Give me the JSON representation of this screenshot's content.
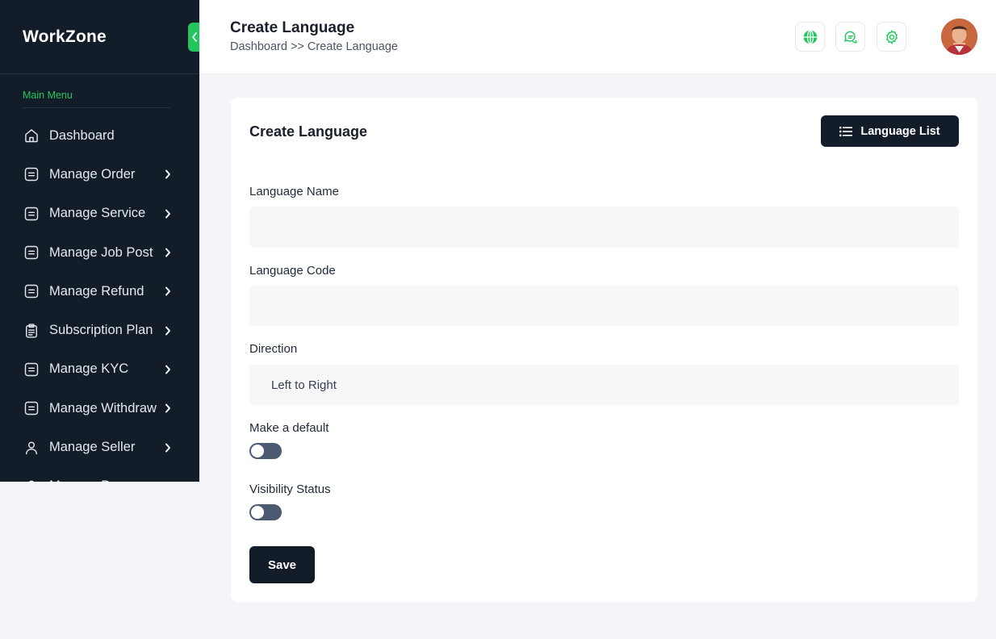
{
  "sidebar": {
    "brand": "WorkZone",
    "menu_label": "Main Menu",
    "items": [
      {
        "label": "Dashboard",
        "icon": "home-icon",
        "has_chevron": false
      },
      {
        "label": "Manage Order",
        "icon": "list-box-icon",
        "has_chevron": true
      },
      {
        "label": "Manage Service",
        "icon": "list-box-icon",
        "has_chevron": true
      },
      {
        "label": "Manage Job Post",
        "icon": "list-box-icon",
        "has_chevron": true
      },
      {
        "label": "Manage Refund",
        "icon": "list-box-icon",
        "has_chevron": true
      },
      {
        "label": "Subscription Plan",
        "icon": "clipboard-icon",
        "has_chevron": true
      },
      {
        "label": "Manage KYC",
        "icon": "list-box-icon",
        "has_chevron": true
      },
      {
        "label": "Manage Withdraw",
        "icon": "list-box-icon",
        "has_chevron": true
      },
      {
        "label": "Manage Seller",
        "icon": "user-icon",
        "has_chevron": true
      },
      {
        "label": "Manage Buyer",
        "icon": "user-icon",
        "has_chevron": true
      }
    ]
  },
  "header": {
    "title": "Create Language",
    "breadcrumb": "Dashboard >> Create Language",
    "icons": [
      "globe-icon",
      "chat-icon",
      "gear-icon"
    ]
  },
  "card": {
    "title": "Create Language",
    "list_button": "Language List",
    "fields": {
      "name_label": "Language Name",
      "name_value": "",
      "code_label": "Language Code",
      "code_value": "",
      "direction_label": "Direction",
      "direction_value": "Left to Right",
      "default_label": "Make a default",
      "default_on": false,
      "visibility_label": "Visibility Status",
      "visibility_on": false
    },
    "save_button": "Save"
  },
  "colors": {
    "sidebar_bg": "#131d29",
    "accent": "#22c55e",
    "toggle_off": "#4b5a70"
  }
}
